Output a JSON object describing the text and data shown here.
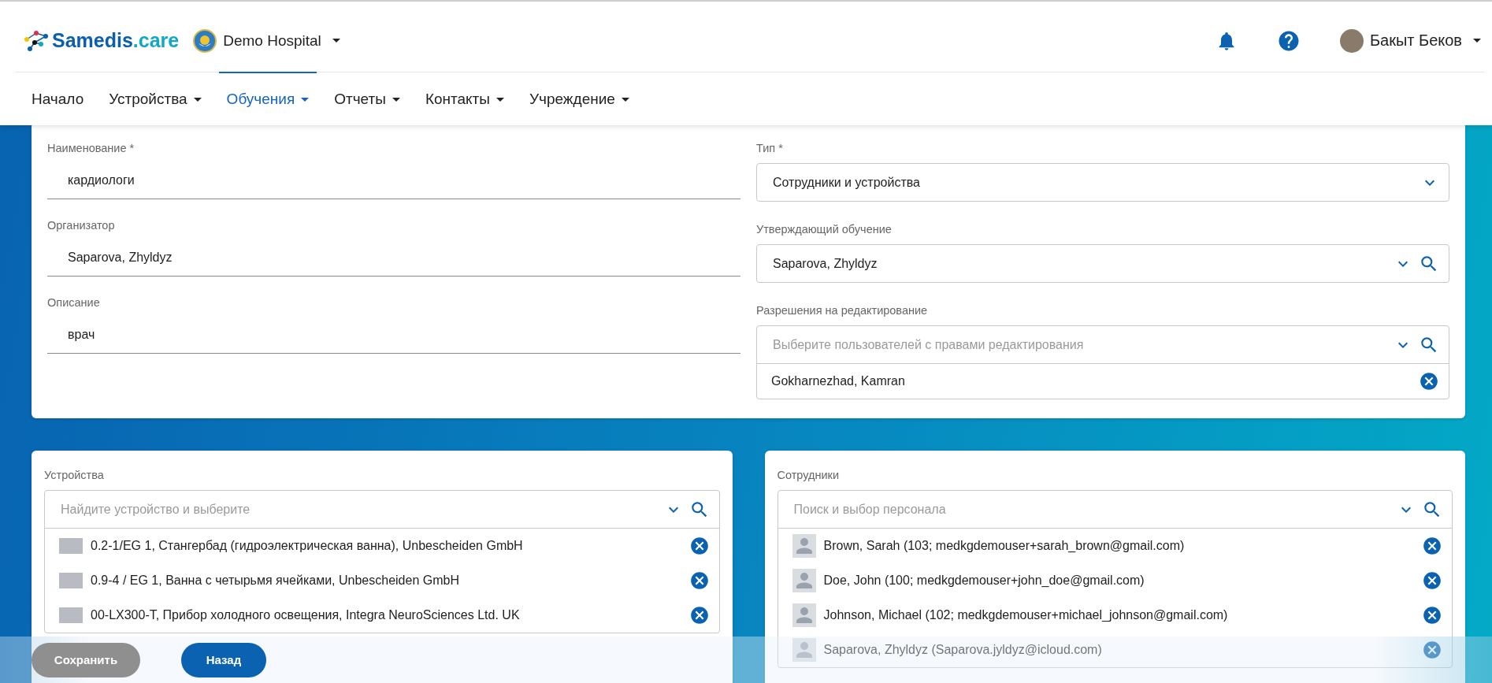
{
  "header": {
    "logo": {
      "name": "Samedis",
      "suffix": ".care"
    },
    "organization": "Demo Hospital",
    "user": "Бакыт Беков"
  },
  "nav": [
    {
      "label": "Начало",
      "dropdown": false,
      "selected": false
    },
    {
      "label": "Устройства",
      "dropdown": true,
      "selected": false
    },
    {
      "label": "Обучения",
      "dropdown": true,
      "selected": true
    },
    {
      "label": "Отчеты",
      "dropdown": true,
      "selected": false
    },
    {
      "label": "Контакты",
      "dropdown": true,
      "selected": false
    },
    {
      "label": "Учреждение",
      "dropdown": true,
      "selected": false
    }
  ],
  "training": {
    "left_fields": [
      {
        "label": "Наименование *",
        "value": "кардиологи"
      },
      {
        "label": "Организатор",
        "value": "Saparova, Zhyldyz"
      },
      {
        "label": "Описание",
        "value": "врач"
      }
    ],
    "type": {
      "label": "Тип *",
      "value": "Сотрудники и устройства"
    },
    "approver": {
      "label": "Утверждающий обучение",
      "value": "Saparova, Zhyldyz"
    },
    "edit_permissions": {
      "label": "Разрешения на редактирование",
      "placeholder": "Выберите пользователей с правами редактирования",
      "items": [
        "Gokharnezhad, Kamran"
      ]
    }
  },
  "devices": {
    "label": "Устройства",
    "placeholder": "Найдите устройство и выберите",
    "items": [
      "0.2-1/EG 1, Стангербад (гидроэлектрическая ванна), Unbescheiden GmbH",
      "0.9-4 / EG 1, Ванна с четырьмя ячейками, Unbescheiden GmbH",
      "00-LX300-T, Прибор холодного освещения, Integra NeuroSciences Ltd. UK"
    ]
  },
  "staff": {
    "label": "Сотрудники",
    "placeholder": "Поиск и выбор персонала",
    "items": [
      "Brown, Sarah (103; medkgdemouser+sarah_brown@gmail.com)",
      "Doe, John (100; medkgdemouser+john_doe@gmail.com)",
      "Johnson, Michael (102; medkgdemouser+michael_johnson@gmail.com)",
      "Saparova, Zhyldyz (Saparova.jyldyz@icloud.com)"
    ]
  },
  "footer_buttons": [
    {
      "label": "Сохранить",
      "disabled": true
    },
    {
      "label": "Назад",
      "disabled": false
    }
  ]
}
